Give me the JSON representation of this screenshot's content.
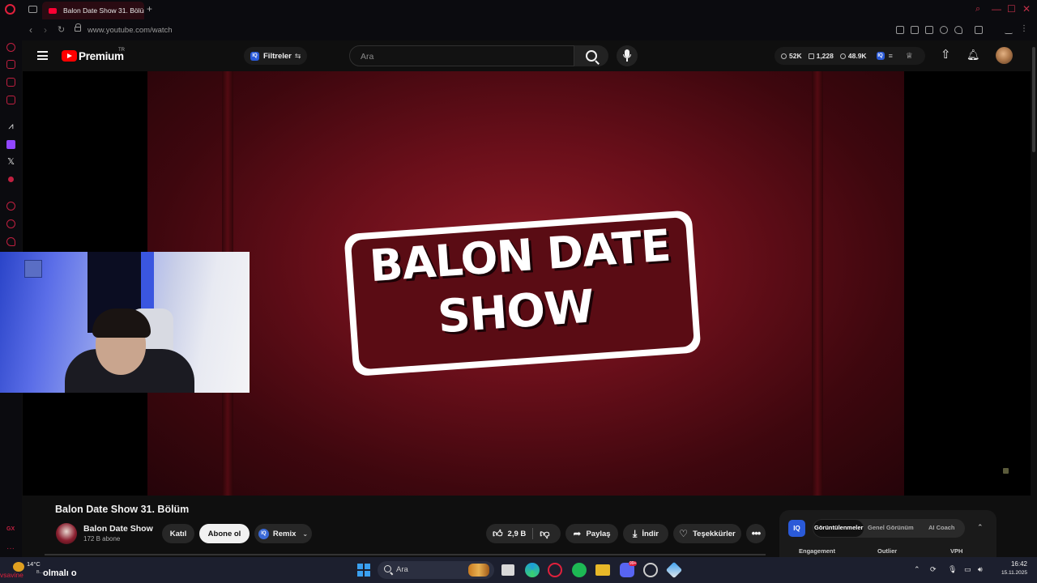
{
  "browser": {
    "tab_title": "Balon Date Show 31. Bölüm",
    "new_tab": "+",
    "url": "www.youtube.com/watch",
    "extension_badge": "E",
    "window_controls": [
      "—",
      "☐",
      "✕"
    ]
  },
  "youtube": {
    "brand": "Premium",
    "country": "TR",
    "filters_label": "Filtreler",
    "search_placeholder": "Ara",
    "stats": {
      "views": "52K",
      "likes": "1,228",
      "watching": "48.9K"
    }
  },
  "video": {
    "logo_line1": "BALON DATE",
    "logo_line2": "SHOW",
    "title": "Balon Date Show 31. Bölüm",
    "channel_name": "Balon Date Show",
    "subscribers": "172 B abone",
    "join_label": "Katıl",
    "subscribe_label": "Abone ol",
    "remix_label": "Remix",
    "likes": "2,9 B",
    "share_label": "Paylaş",
    "download_label": "İndir",
    "thanks_label": "Teşekkürler",
    "more_label": "•••"
  },
  "vidiq": {
    "logo": "IQ",
    "tabs": [
      "Görüntülenmeler",
      "Genel Görünüm",
      "AI Coach"
    ],
    "active_tab": 0,
    "columns": [
      "Engagement",
      "Outlier",
      "VPH"
    ]
  },
  "taskbar": {
    "temperature": "14°C",
    "weather_sub": "B...",
    "overlay_red": "vsavine",
    "overlay_text": "olmalı o",
    "search_label": "Ara",
    "time": "16:42",
    "date": "15.11.2025",
    "discord_badge": "99+"
  }
}
